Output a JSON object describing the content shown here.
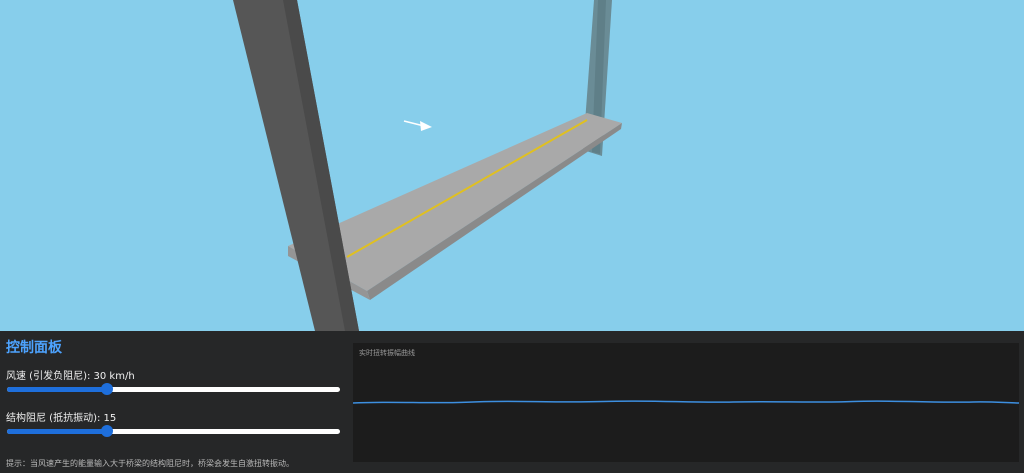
{
  "panel": {
    "title": "控制面板",
    "wind": {
      "label": "风速 (引发负阻尼): 30 km/h",
      "value": 30,
      "min": 0,
      "max": 100
    },
    "damping": {
      "label": "结构阻尼 (抵抗振动): 15",
      "value": 15,
      "min": 0,
      "max": 50
    },
    "hint": "提示：当风速产生的能量输入大于桥梁的结构阻尼时，桥梁会发生自激扭转振动。"
  },
  "chart": {
    "title": "实时扭转振幅曲线",
    "line_color": "#3d8fe0"
  },
  "colors": {
    "sky": "#87CEEB",
    "accent": "#4da3ff",
    "slider": "#1e6fdc",
    "tower": "#5a5a5a",
    "deck": "#a9a9a9",
    "center_line": "#e0c020"
  }
}
